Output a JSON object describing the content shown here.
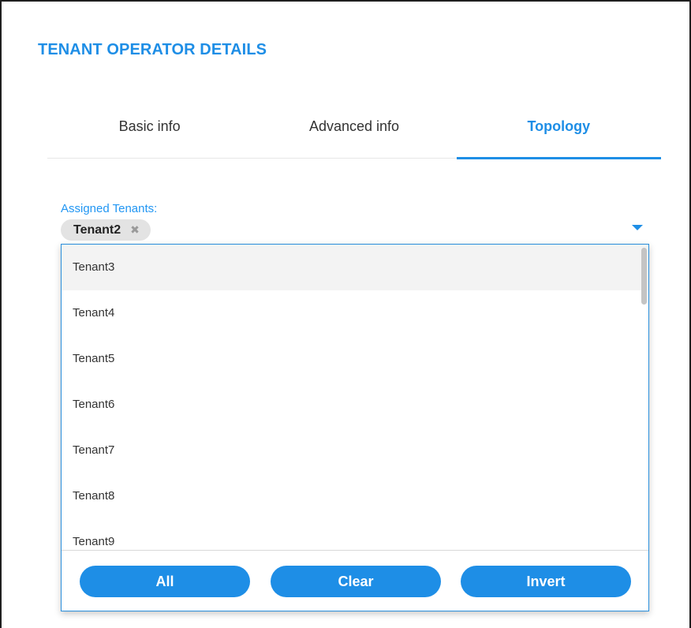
{
  "page_title": "TENANT OPERATOR DETAILS",
  "tabs": [
    {
      "label": "Basic info"
    },
    {
      "label": "Advanced info"
    },
    {
      "label": "Topology",
      "active": true
    }
  ],
  "assigned_tenants": {
    "label": "Assigned Tenants:",
    "selected": [
      {
        "label": "Tenant2",
        "remove_icon": "close-icon"
      }
    ],
    "dropdown_icon": "caret-down-icon"
  },
  "dropdown": {
    "options": [
      "Tenant3",
      "Tenant4",
      "Tenant5",
      "Tenant6",
      "Tenant7",
      "Tenant8",
      "Tenant9"
    ],
    "highlighted": "Tenant3",
    "buttons": {
      "all": "All",
      "clear": "Clear",
      "invert": "Invert"
    }
  },
  "colors": {
    "accent": "#1e8ee6",
    "chip_bg": "#e3e3e3",
    "highlight_row": "#f3f3f3"
  }
}
